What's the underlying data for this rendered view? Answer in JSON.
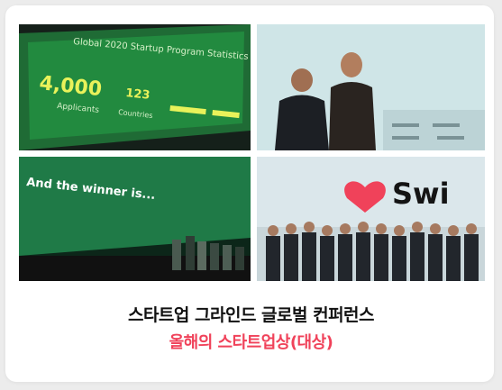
{
  "accent": "#f0425a",
  "card": {
    "title": "스타트업 그라인드 글로벌 컨퍼런스",
    "subtitle": "올해의 스타트업상(대상)"
  },
  "photos": [
    {
      "name": "slide",
      "screen_values": [
        "4,000",
        "123",
        "Applicants",
        "Countries",
        "Global 2020 Startup Program Statistics"
      ]
    },
    {
      "name": "speakers-on-stage"
    },
    {
      "name": "winner-announcement",
      "screen_text": "And the winner is..."
    },
    {
      "name": "team-on-stage",
      "brand_text": "Swi"
    }
  ]
}
